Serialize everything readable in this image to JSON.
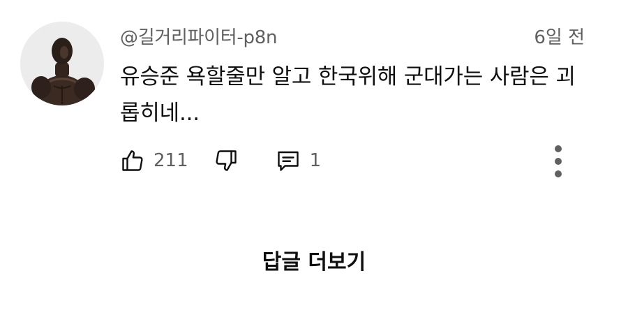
{
  "comment": {
    "author": "@길거리파이터-p8n",
    "timestamp": "6일 전",
    "text": "유승준 욕할줄만 알고 한국위해 군대가는 사람은 괴롭히네...",
    "likes": "211",
    "replies": "1"
  },
  "icons": {
    "like": "thumb-up-icon",
    "dislike": "thumb-down-icon",
    "reply": "comment-icon",
    "more": "more-vertical-icon"
  },
  "colors": {
    "text": "#0f0f0f",
    "secondary": "#606060",
    "background": "#ffffff"
  },
  "footer": {
    "more_replies_label": "답글 더보기"
  }
}
